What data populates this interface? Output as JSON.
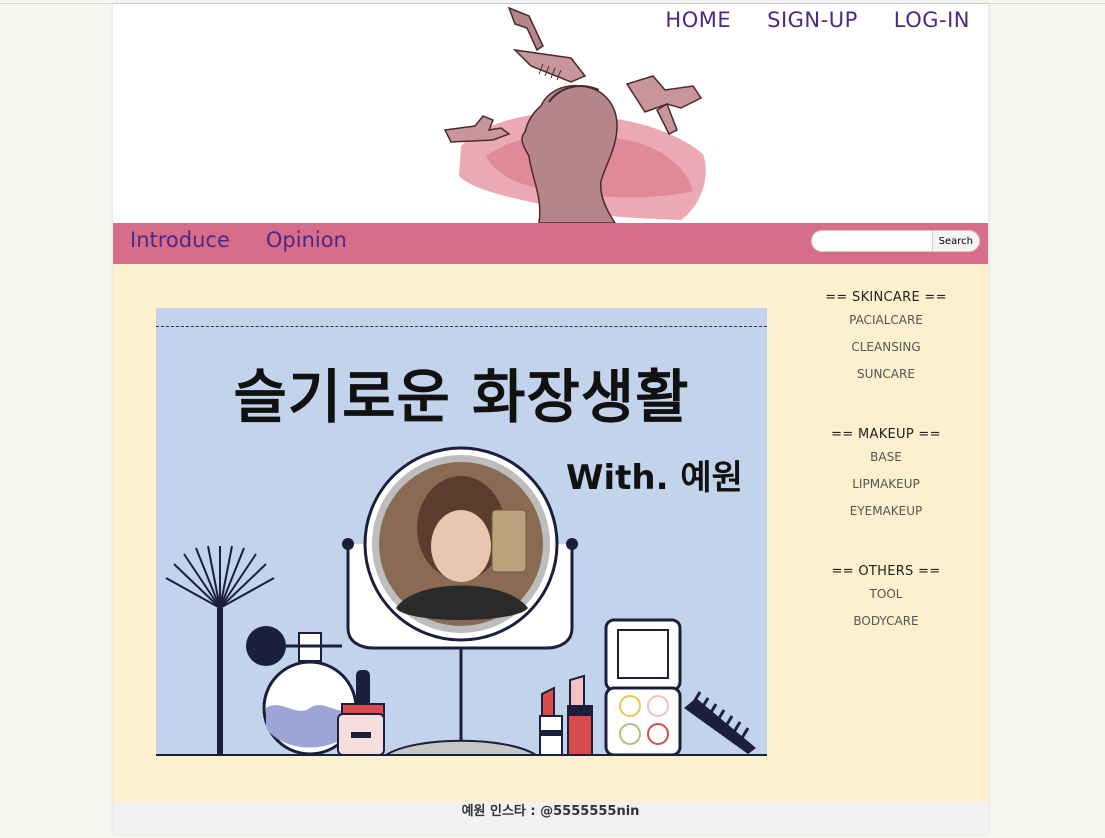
{
  "top_nav": {
    "home": "HOME",
    "signup": "SIGN-UP",
    "login": "LOG-IN"
  },
  "main_nav": {
    "introduce": "Introduce",
    "opinion": "Opinion"
  },
  "search": {
    "placeholder": "",
    "button": "Search"
  },
  "banner": {
    "title": "슬기로운 화장생활",
    "subtitle": "With. 예원"
  },
  "sidebar": {
    "groups": [
      {
        "heading": "== SKINCARE ==",
        "items": [
          "PACIALCARE",
          "CLEANSING",
          "SUNCARE"
        ]
      },
      {
        "heading": "== MAKEUP ==",
        "items": [
          "BASE",
          "LIPMAKEUP",
          "EYEMAKEUP"
        ]
      },
      {
        "heading": "== OTHERS ==",
        "items": [
          "TOOL",
          "BODYCARE"
        ]
      }
    ]
  },
  "footer": {
    "text": "예원 인스타 : @5555555nin"
  },
  "colors": {
    "nav_bar": "#d76d8b",
    "nav_text": "#4a2a86",
    "content_bg": "#fcf0cf",
    "banner_bg": "#c1d4ec",
    "logo_pink": "#e79aa6"
  },
  "icons": [
    "beauty-silhouette-logo",
    "mirror-icon",
    "fan-brush-icon",
    "perfume-icon",
    "lipstick-icon",
    "palette-icon",
    "comb-icon"
  ]
}
